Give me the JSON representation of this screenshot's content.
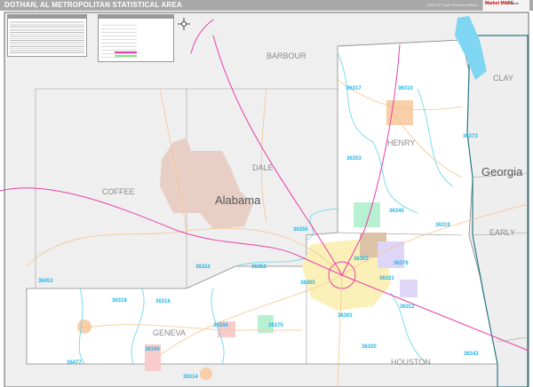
{
  "header": {
    "title": "DOTHAN, AL METROPOLITAN STATISTICAL AREA",
    "edition": "2020 ZIP Code Premium Edition",
    "logo_text": "Market MAPS",
    "logo_sub": "Outlook"
  },
  "colors": {
    "water": "#7fd6f2",
    "zip_line": "#5fd3ec",
    "highway": "#e83fa8",
    "road": "#f6c48f",
    "outside": "#efefef",
    "inside": "#ffffff",
    "state_line": "#2a7a86"
  },
  "map": {
    "states": [
      {
        "name": "Alabama"
      },
      {
        "name": "Georgia"
      }
    ],
    "counties": [
      {
        "name": "BARBOUR"
      },
      {
        "name": "CLAY"
      },
      {
        "name": "HENRY"
      },
      {
        "name": "DALE"
      },
      {
        "name": "COFFEE"
      },
      {
        "name": "EARLY"
      },
      {
        "name": "GENEVA"
      },
      {
        "name": "HOUSTON"
      }
    ],
    "zips": [
      "36317",
      "36310",
      "36373",
      "36353",
      "36345",
      "36319",
      "36350",
      "36322",
      "36352",
      "36303",
      "36376",
      "36321",
      "36305",
      "36312",
      "36301",
      "36320",
      "36343",
      "36453",
      "36318",
      "36316",
      "36344",
      "36340",
      "36477",
      "36314",
      "36375"
    ]
  }
}
